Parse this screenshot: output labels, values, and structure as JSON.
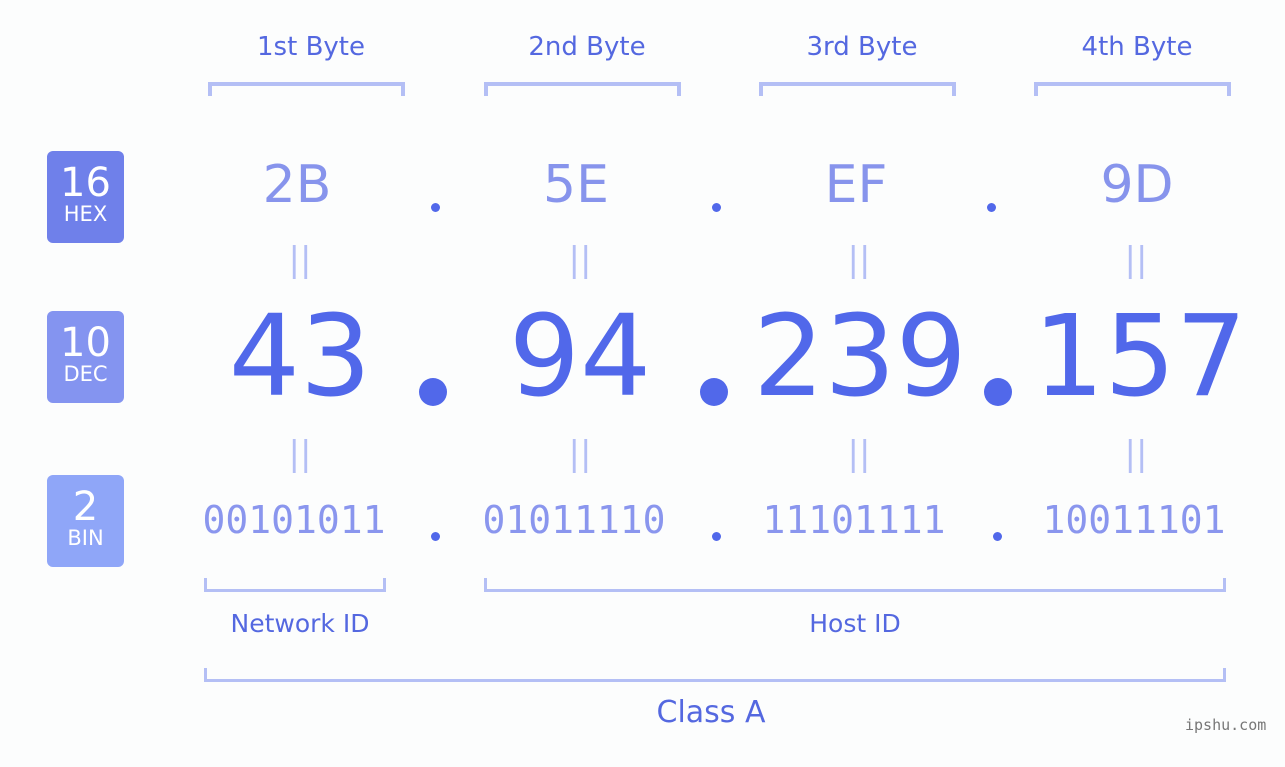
{
  "badges": [
    {
      "number": "16",
      "label": "HEX",
      "color": "#6f80ea"
    },
    {
      "number": "10",
      "label": "DEC",
      "color": "#8494f0"
    },
    {
      "number": "2",
      "label": "BIN",
      "color": "#8fa6f8"
    }
  ],
  "bytes": [
    {
      "header": "1st Byte",
      "hex": "2B",
      "dec": "43",
      "bin": "00101011"
    },
    {
      "header": "2nd Byte",
      "hex": "5E",
      "dec": "94",
      "bin": "01011110"
    },
    {
      "header": "3rd Byte",
      "hex": "EF",
      "dec": "239",
      "bin": "11101111"
    },
    {
      "header": "4th Byte",
      "hex": "9D",
      "dec": "157",
      "bin": "10011101"
    }
  ],
  "equals_sign": "||",
  "segments": {
    "network": "Network ID",
    "host": "Host ID",
    "class": "Class A"
  },
  "watermark": "ipshu.com",
  "colors": {
    "accent": "#5168ea",
    "bracket": "#b4bff5"
  }
}
